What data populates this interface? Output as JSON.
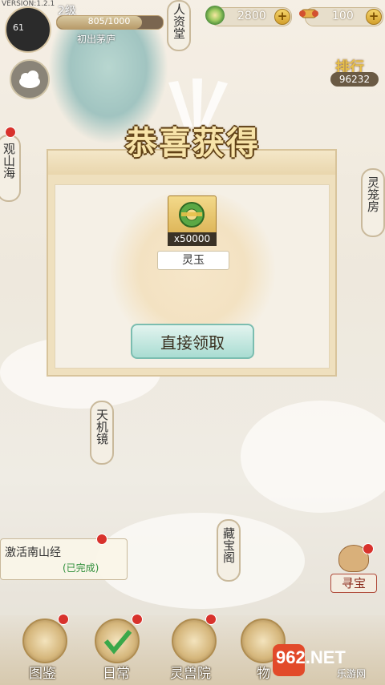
{
  "version": "VERSION:1.2.1",
  "player": {
    "name": "61",
    "level": "2级",
    "exp": "805/1000",
    "exp_fraction": 0.805,
    "rank_title": "初出茅庐"
  },
  "currency": {
    "coins": "2800",
    "tickets": "100",
    "plus": "+"
  },
  "ranking": {
    "label": "排行",
    "value": "96232"
  },
  "side_tabs": {
    "left_top": "人资堂",
    "left_mountain": "观山海",
    "right": "灵笼房",
    "tianji": "天机镜",
    "cangbao": "藏宝阁"
  },
  "modal": {
    "title": "恭喜获得",
    "item": {
      "name": "灵玉",
      "quantity": "x50000"
    },
    "claim_button": "直接领取"
  },
  "quest": {
    "title": "激活南山经",
    "status": "(已完成)"
  },
  "treasure": "寻宝",
  "bottom_nav": [
    {
      "label": "图鉴"
    },
    {
      "label": "日常"
    },
    {
      "label": "灵兽院"
    },
    {
      "label": "物"
    }
  ],
  "watermark": {
    "text": "962.NET",
    "sub": "乐游网"
  },
  "colors": {
    "reward_gold": "#f7e3a8",
    "claim_teal": "#a9dcd2",
    "reddot": "#d8322c"
  }
}
